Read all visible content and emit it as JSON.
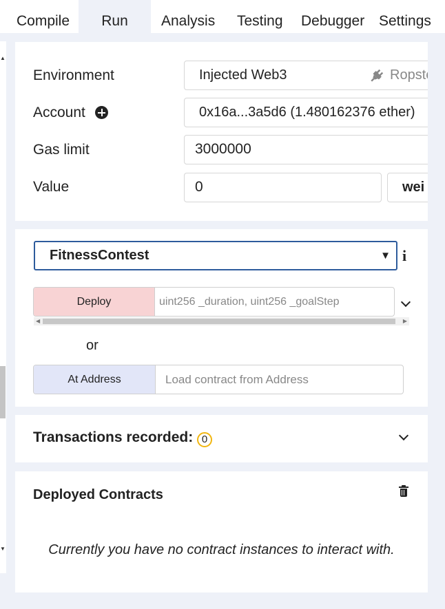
{
  "tabs": [
    "Compile",
    "Run",
    "Analysis",
    "Testing",
    "Debugger",
    "Settings"
  ],
  "active_tab": "Run",
  "env": {
    "environment_label": "Environment",
    "environment_value": "Injected Web3",
    "network": "Ropste",
    "account_label": "Account",
    "account_value": "0x16a...3a5d6 (1.480162376 ether)",
    "gas_label": "Gas limit",
    "gas_value": "3000000",
    "value_label": "Value",
    "value_amount": "0",
    "value_unit": "wei"
  },
  "contract": {
    "selected": "FitnessContest",
    "deploy_label": "Deploy",
    "deploy_placeholder": "uint256 _duration, uint256 _goalStep",
    "or_text": "or",
    "at_address_label": "At Address",
    "at_address_placeholder": "Load contract from Address"
  },
  "transactions": {
    "label": "Transactions recorded:",
    "count": "0"
  },
  "deployed": {
    "title": "Deployed Contracts",
    "empty_message": "Currently you have no contract instances to interact with."
  },
  "colors": {
    "deploy_bg": "#f8d3d4",
    "at_address_bg": "#e2e6f8",
    "badge_border": "#f1b610",
    "select_border": "#2d5b9c"
  }
}
